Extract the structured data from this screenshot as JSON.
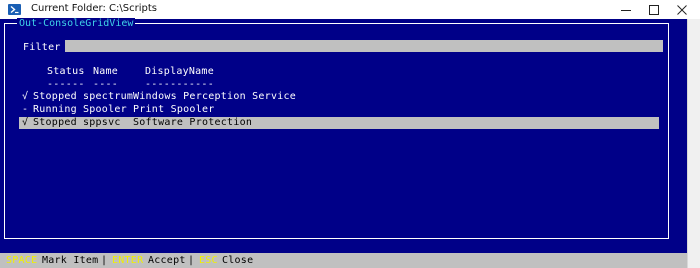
{
  "window": {
    "title": "Current Folder: C:\\Scripts",
    "icon": "powershell-icon"
  },
  "panel": {
    "title": "Out-ConsoleGridView",
    "filter_label": "Filter",
    "filter_value": ""
  },
  "grid": {
    "columns": [
      "Status",
      "Name",
      "DisplayName"
    ],
    "separators": [
      "------",
      "----",
      "-----------"
    ],
    "rows": [
      {
        "mark": "√",
        "status": "Stopped",
        "name": "spectrum",
        "display": "Windows Perception Service",
        "highlighted": false
      },
      {
        "mark": "-",
        "status": "Running",
        "name": "Spooler",
        "display": "Print Spooler",
        "highlighted": false
      },
      {
        "mark": "√",
        "status": "Stopped",
        "name": "sppsvc",
        "display": "Software Protection",
        "highlighted": true
      }
    ]
  },
  "statusbar": {
    "items": [
      {
        "key": "SPACE",
        "label": "Mark Item"
      },
      {
        "key": "ENTER",
        "label": "Accept"
      },
      {
        "key": "ESC",
        "label": "Close"
      }
    ],
    "divider": "|"
  },
  "colors": {
    "console_bg": "#000088",
    "panel_title": "#3fd2e8",
    "highlight_row": "#c0c0c0",
    "statusbar_bg": "#c0c0c0",
    "key_text": "#f0f000"
  }
}
